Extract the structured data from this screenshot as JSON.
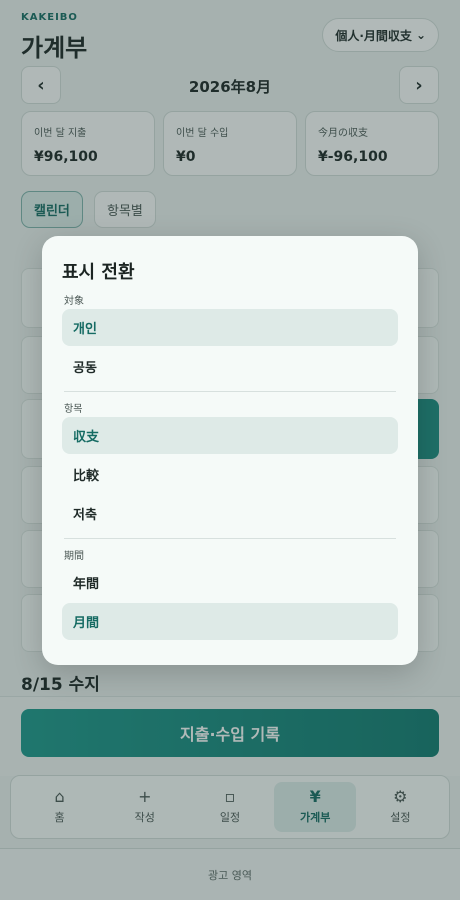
{
  "header": {
    "brand": "KAKEIBO",
    "title": "가계부",
    "mode_label": "個人·月間収支",
    "mode_chevron": "⌄"
  },
  "month_nav": {
    "prev": "‹",
    "next": "›",
    "label": "2026年8月"
  },
  "stats": [
    {
      "label": "이번 달 지출",
      "value": "¥96,100"
    },
    {
      "label": "이번 달 수입",
      "value": "¥0"
    },
    {
      "label": "今月の収支",
      "value": "¥-96,100"
    }
  ],
  "view_tabs": [
    {
      "label": "캘린더",
      "active": true
    },
    {
      "label": "항목별",
      "active": false
    }
  ],
  "day_title": "8/15 수지",
  "record_button": "지출·수입 기록",
  "tabbar": [
    {
      "icon": "home-icon",
      "glyph": "⌂",
      "label": "홈",
      "active": false
    },
    {
      "icon": "plus-icon",
      "glyph": "+",
      "label": "작성",
      "active": false
    },
    {
      "icon": "calendar-icon",
      "glyph": "▫",
      "label": "일정",
      "active": false
    },
    {
      "icon": "yen-icon",
      "glyph": "¥",
      "label": "가계부",
      "active": true
    },
    {
      "icon": "gear-icon",
      "glyph": "⚙",
      "label": "설정",
      "active": false
    }
  ],
  "ad_label": "광고 영역",
  "modal": {
    "title": "표시 전환",
    "sections": [
      {
        "label": "対象",
        "options": [
          {
            "label": "개인",
            "selected": true
          },
          {
            "label": "공동",
            "selected": false
          }
        ]
      },
      {
        "label": "항목",
        "options": [
          {
            "label": "収支",
            "selected": true
          },
          {
            "label": "比較",
            "selected": false
          },
          {
            "label": "저축",
            "selected": false
          }
        ]
      },
      {
        "label": "期間",
        "options": [
          {
            "label": "年間",
            "selected": false
          },
          {
            "label": "月間",
            "selected": true
          }
        ]
      }
    ]
  },
  "colors": {
    "accent": "#156b63",
    "accent_button": "#1c978b",
    "selected_bg": "#deeae7"
  }
}
